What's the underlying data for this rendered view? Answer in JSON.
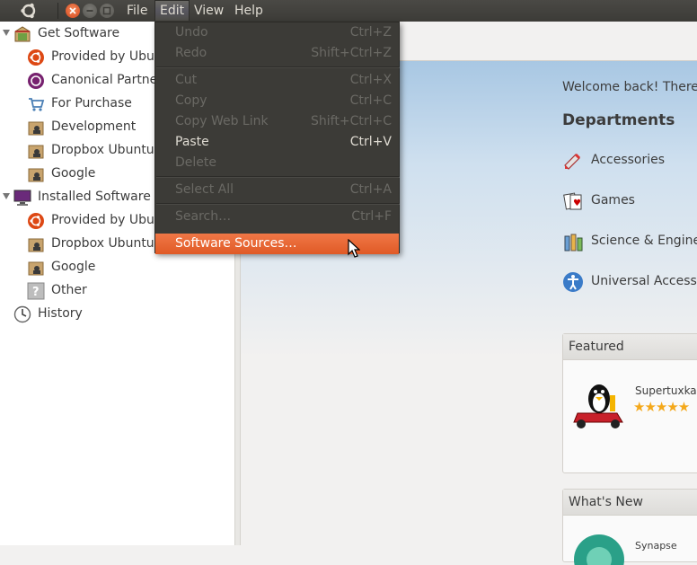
{
  "menubar": {
    "items": [
      {
        "label": "File"
      },
      {
        "label": "Edit"
      },
      {
        "label": "View"
      },
      {
        "label": "Help"
      }
    ]
  },
  "sidebar": {
    "items": [
      {
        "label": "Get Software",
        "icon": "get-software-icon"
      },
      {
        "label": "Provided by Ubuntu",
        "icon": "ubuntu-icon"
      },
      {
        "label": "Canonical Partners",
        "icon": "canonical-icon"
      },
      {
        "label": "For Purchase",
        "icon": "cart-icon"
      },
      {
        "label": "Development",
        "icon": "package-icon"
      },
      {
        "label": "Dropbox Ubuntu",
        "icon": "package-icon"
      },
      {
        "label": "Google",
        "icon": "package-icon"
      },
      {
        "label": "Installed Software",
        "icon": "monitor-icon"
      },
      {
        "label": "Provided by Ubuntu",
        "icon": "ubuntu-icon"
      },
      {
        "label": "Dropbox Ubuntu",
        "icon": "package-icon"
      },
      {
        "label": "Google",
        "icon": "package-icon"
      },
      {
        "label": "Other",
        "icon": "question-icon"
      },
      {
        "label": "History",
        "icon": "history-icon"
      }
    ]
  },
  "edit_menu": {
    "items": [
      {
        "label": "Undo",
        "accel": "Ctrl+Z",
        "state": "disabled"
      },
      {
        "label": "Redo",
        "accel": "Shift+Ctrl+Z",
        "state": "disabled"
      },
      {
        "label": "Cut",
        "accel": "Ctrl+X",
        "state": "disabled"
      },
      {
        "label": "Copy",
        "accel": "Ctrl+C",
        "state": "disabled"
      },
      {
        "label": "Copy Web Link",
        "accel": "Shift+Ctrl+C",
        "state": "disabled"
      },
      {
        "label": "Paste",
        "accel": "Ctrl+V",
        "state": "enabled"
      },
      {
        "label": "Delete",
        "accel": "",
        "state": "disabled"
      },
      {
        "label": "Select All",
        "accel": "Ctrl+A",
        "state": "disabled"
      },
      {
        "label": "Search…",
        "accel": "Ctrl+F",
        "state": "disabled"
      },
      {
        "label": "Software Sources…",
        "accel": "",
        "state": "highlighted"
      }
    ]
  },
  "main": {
    "welcome": "Welcome back! There a",
    "departments_title": "Departments",
    "departments": [
      {
        "label": "Accessories",
        "icon": "accessories-icon"
      },
      {
        "label": "Games",
        "icon": "games-icon"
      },
      {
        "label": "Science & Enginee",
        "icon": "science-icon"
      },
      {
        "label": "Universal Access",
        "icon": "accessibility-icon"
      }
    ],
    "featured": {
      "title": "Featured",
      "app_name": "Supertuxkart",
      "stars": "★★★★★"
    },
    "whats_new": {
      "title": "What's New",
      "app_name": "Synapse"
    }
  },
  "colors": {
    "accent": "#e95420",
    "panel": "#3c3b37"
  }
}
